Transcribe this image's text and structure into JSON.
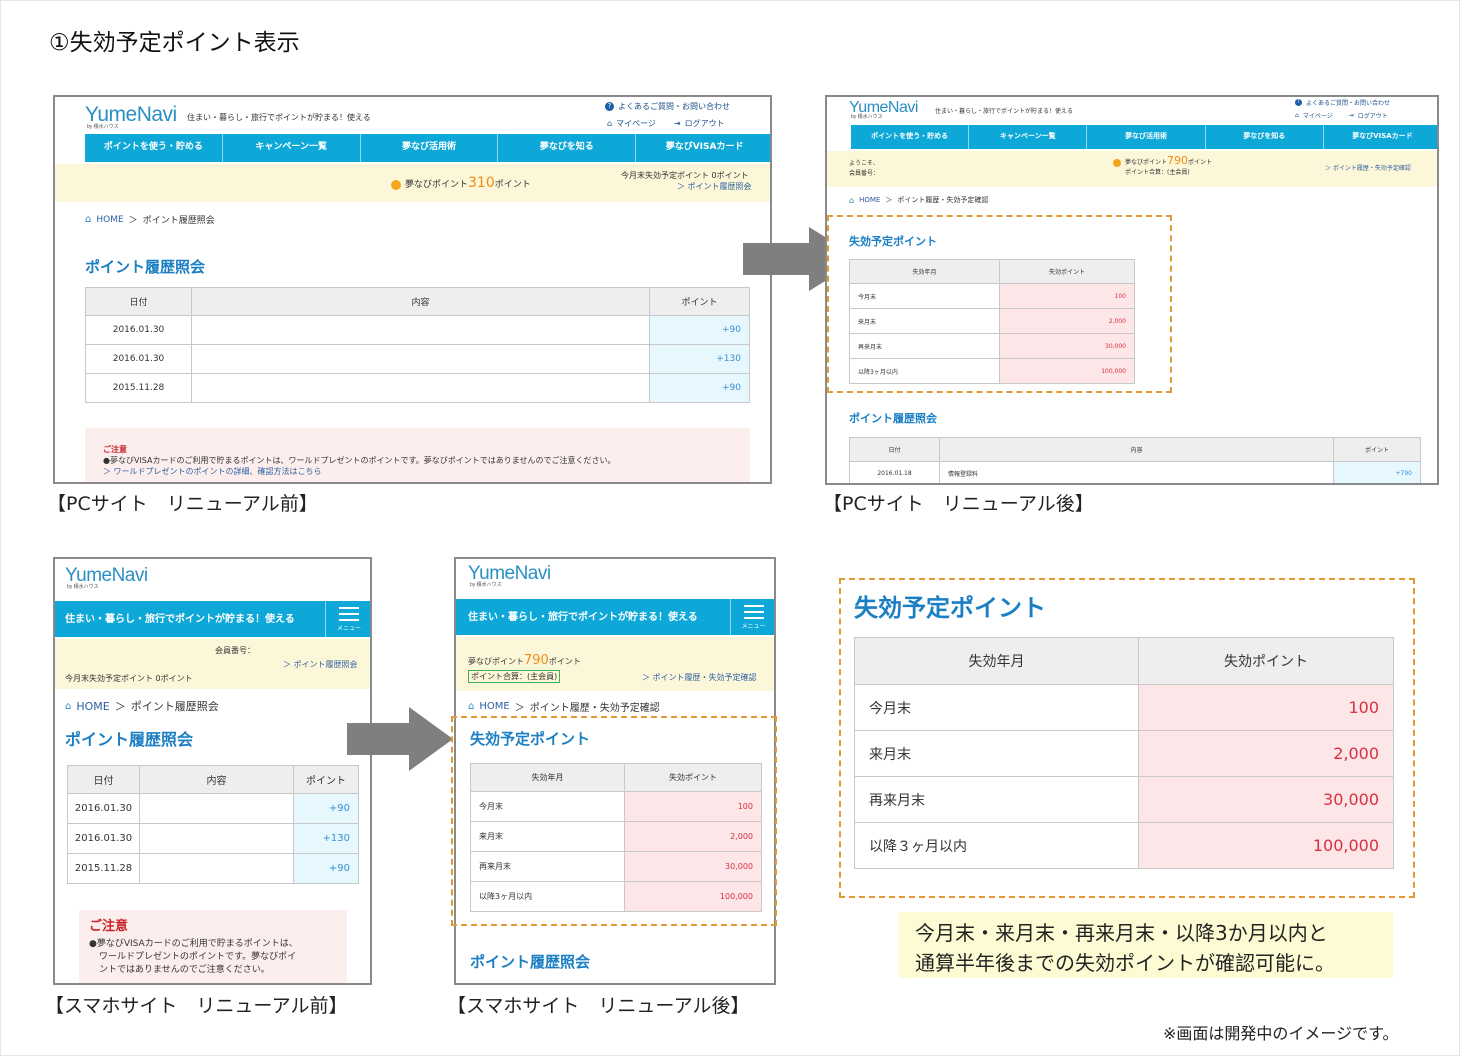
{
  "title": "①失効予定ポイント表示",
  "captions": {
    "pc_before": "【PCサイト　リニューアル前】",
    "pc_after": "【PCサイト　リニューアル後】",
    "sp_before": "【スマホサイト　リニューアル前】",
    "sp_after": "【スマホサイト　リニューアル後】"
  },
  "site": {
    "logo": "YumeNavi",
    "logo_by": "by 積水ハウス",
    "tagline": "住まい・暮らし・旅行でポイントが貯まる！使える",
    "faq_link": "よくあるご質問・お問い合わせ",
    "mypage_link": "マイページ",
    "logout_link": "ログアウト",
    "nav": [
      "ポイントを使う・貯める",
      "キャンペーン一覧",
      "夢なび活用術",
      "夢なびを知る",
      "夢なびVISAカード"
    ],
    "menu_label": "メニュー",
    "home": "HOME",
    "breadcrumb_sep": "＞"
  },
  "pc_before": {
    "points_label": "夢なびポイント",
    "points_value": "310",
    "points_unit": "ポイント",
    "expire_text": "今月末失効予定ポイント 0ポイント",
    "history_link": "＞ ポイント履歴照会",
    "breadcrumb_page": "ポイント履歴照会",
    "heading": "ポイント履歴照会",
    "table_headers": [
      "日付",
      "内容",
      "ポイント"
    ],
    "rows": [
      {
        "date": "2016.01.30",
        "content": "",
        "points": "+90"
      },
      {
        "date": "2016.01.30",
        "content": "",
        "points": "+130"
      },
      {
        "date": "2015.11.28",
        "content": "",
        "points": "+90"
      }
    ],
    "notice_title": "ご注意",
    "notice_text": "●夢なびVISAカードのご利用で貯まるポイントは、ワールドプレゼントのポイントです。夢なびポイントではありませんのでご注意ください。",
    "notice_link": "＞ ワールドプレゼントのポイントの詳細、確認方法はこちら"
  },
  "pc_after": {
    "greeting": "ようこそ、",
    "member_no": "会員番号：",
    "points_label": "夢なびポイント",
    "points_value": "790",
    "points_unit": "ポイント",
    "points_total": "ポイント合算：(主会員)",
    "history_link": "＞ ポイント履歴・失効予定確認",
    "breadcrumb_page": "ポイント履歴・失効予定確認",
    "expire_heading": "失効予定ポイント",
    "expire_headers": [
      "失効年月",
      "失効ポイント"
    ],
    "expire_rows": [
      {
        "label": "今月末",
        "value": "100"
      },
      {
        "label": "来月末",
        "value": "2,000"
      },
      {
        "label": "再来月末",
        "value": "30,000"
      },
      {
        "label": "以降3ヶ月以内",
        "value": "100,000"
      }
    ],
    "history_heading": "ポイント履歴照会",
    "table_headers": [
      "日付",
      "内容",
      "ポイント"
    ],
    "rows": [
      {
        "date": "2016.01.18",
        "content": "情報登録料",
        "points": "+790"
      }
    ]
  },
  "sp_before": {
    "member_no": "会員番号：",
    "history_link": "＞ ポイント履歴照会",
    "expire_text": "今月末失効予定ポイント 0ポイント",
    "breadcrumb_page": "ポイント履歴照会",
    "heading": "ポイント履歴照会",
    "table_headers": [
      "日付",
      "内容",
      "ポイント"
    ],
    "rows": [
      {
        "date": "2016.01.30",
        "content": "",
        "points": "+90"
      },
      {
        "date": "2016.01.30",
        "content": "",
        "points": "+130"
      },
      {
        "date": "2015.11.28",
        "content": "",
        "points": "+90"
      }
    ],
    "notice_title": "ご注意",
    "notice_line1": "●夢なびVISAカードのご利用で貯まるポイントは、",
    "notice_line2": "ワールドプレゼントのポイントです。夢なびポイ",
    "notice_line3": "ントではありませんのでご注意ください。"
  },
  "sp_after": {
    "points_label": "夢なびポイント",
    "points_value": "790",
    "points_unit": "ポイント",
    "points_total": "ポイント合算：(主会員)",
    "history_link": "＞ ポイント履歴・失効予定確認",
    "breadcrumb_page": "ポイント履歴・失効予定確認",
    "expire_heading": "失効予定ポイント",
    "expire_headers": [
      "失効年月",
      "失効ポイント"
    ],
    "expire_rows": [
      {
        "label": "今月末",
        "value": "100"
      },
      {
        "label": "来月末",
        "value": "2,000"
      },
      {
        "label": "再来月末",
        "value": "30,000"
      },
      {
        "label": "以降3ヶ月以内",
        "value": "100,000"
      }
    ],
    "history_heading": "ポイント履歴照会"
  },
  "zoom": {
    "heading": "失効予定ポイント",
    "headers": [
      "失効年月",
      "失効ポイント"
    ],
    "rows": [
      {
        "label": "今月末",
        "value": "100"
      },
      {
        "label": "来月末",
        "value": "2,000"
      },
      {
        "label": "再来月末",
        "value": "30,000"
      },
      {
        "label": "以降３ヶ月以内",
        "value": "100,000"
      }
    ]
  },
  "note": {
    "line1": "今月末・来月末・再来月末・以降3か月以内と",
    "line2": "通算半年後までの失効ポイントが確認可能に。"
  },
  "footnote": "※画面は開発中のイメージです。",
  "colors": {
    "accent_blue": "#0ea8d8",
    "heading_blue": "#1b7fc4",
    "highlight_orange": "#f08c18",
    "pink_cell": "#fde6e8",
    "blue_cell": "#e6f7fd",
    "dashed_border": "#e39a35"
  }
}
